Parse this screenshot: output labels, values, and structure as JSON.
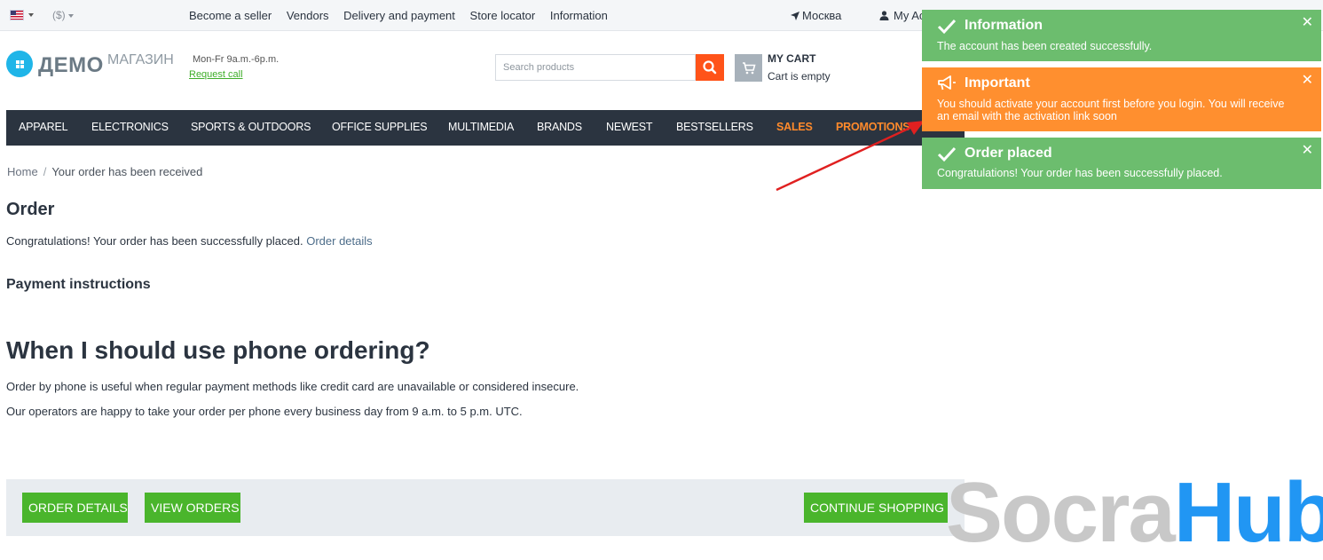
{
  "topbar": {
    "currency": "($)",
    "links": [
      "Become a seller",
      "Vendors",
      "Delivery and payment",
      "Store locator",
      "Information"
    ],
    "location": "Москва",
    "account": "My Ac"
  },
  "header": {
    "logo_main": "ДЕМО",
    "logo_sub": "МАГАЗИН",
    "hours": "Mon-Fr 9a.m.-6p.m.",
    "request_call": "Request call",
    "search_placeholder": "Search products",
    "cart_title": "MY CART",
    "cart_status": "Cart is empty"
  },
  "mainnav": {
    "items": [
      "APPAREL",
      "ELECTRONICS",
      "SPORTS & OUTDOORS",
      "OFFICE SUPPLIES",
      "MULTIMEDIA",
      "BRANDS",
      "NEWEST",
      "BESTSELLERS",
      "SALES",
      "PROMOTIONS"
    ]
  },
  "breadcrumb": {
    "home": "Home",
    "separator": "/",
    "current": "Your order has been received"
  },
  "content": {
    "order_title": "Order",
    "congrats_text": "Congratulations! Your order has been successfully placed.",
    "order_details_link": "Order details",
    "payment_title": "Payment instructions",
    "phone_title": "When I should use phone ordering?",
    "phone_p1": "Order by phone is useful when regular payment methods like credit card are unavailable or considered insecure.",
    "phone_p2": "Our operators are happy to take your order per phone every business day from 9 a.m. to 5 p.m. UTC."
  },
  "buttons": {
    "order_details": "ORDER DETAILS",
    "view_orders": "VIEW ORDERS",
    "continue_shopping": "CONTINUE SHOPPING"
  },
  "notifications": [
    {
      "type": "success",
      "icon": "check-icon",
      "title": "Information",
      "message": "The account has been created successfully."
    },
    {
      "type": "warning",
      "icon": "megaphone-icon",
      "title": "Important",
      "message": "You should activate your account first before you login. You will receive an email with the activation link soon"
    },
    {
      "type": "success",
      "icon": "check-icon",
      "title": "Order placed",
      "message": "Congratulations! Your order has been successfully placed."
    }
  ],
  "watermark": {
    "part1": "Socra",
    "part2": "Hub"
  },
  "colors": {
    "nav_bg": "#2b3440",
    "accent_orange": "#ff5319",
    "button_green": "#4ab52c",
    "notif_green": "#6cbd6e",
    "notif_orange": "#ff8f2f",
    "hot_nav": "#ff8a2b",
    "watermark_blue": "#2196f3",
    "annotation_red": "#e02020"
  }
}
